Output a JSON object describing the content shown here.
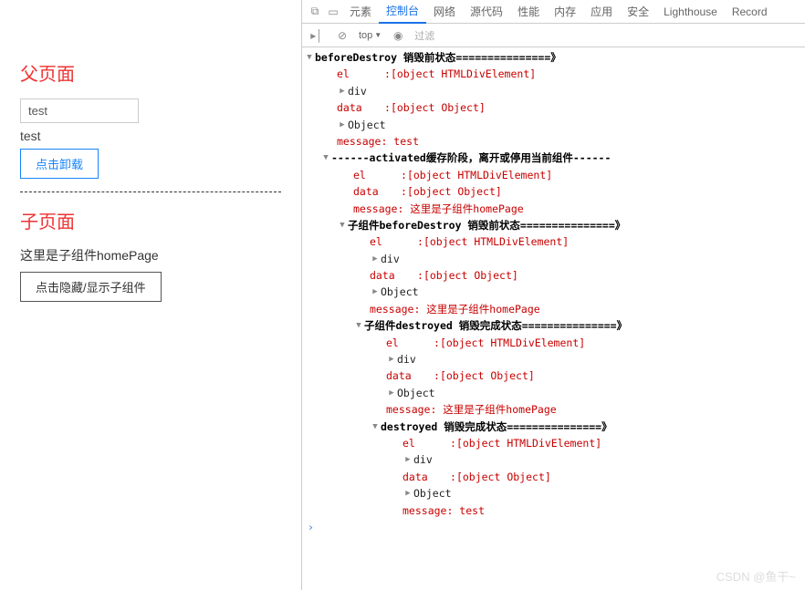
{
  "left": {
    "parentTitle": "父页面",
    "inputValue": "test",
    "echoText": "test",
    "unloadBtn": "点击卸载",
    "childTitle": "子页面",
    "childDesc": "这里是子组件homePage",
    "toggleBtn": "点击隐藏/显示子组件"
  },
  "devtools": {
    "tabs": [
      "元素",
      "控制台",
      "网络",
      "源代码",
      "性能",
      "内存",
      "应用",
      "安全",
      "Lighthouse",
      "Record"
    ],
    "activeTab": "控制台",
    "topSelector": "top",
    "filterPlaceholder": "过滤"
  },
  "log": {
    "g1_header": "beforeDestroy 销毁前状态===============》",
    "g1_el_key": "el",
    "g1_el_val": "[object HTMLDivElement]",
    "g1_div": "div",
    "g1_data_key": "data",
    "g1_data_val": "[object Object]",
    "g1_obj": "Object",
    "g1_msg": "message: test",
    "g2_header": "------activated缓存阶段，离开或停用当前组件------",
    "g2_el_key": "el",
    "g2_el_val": "[object HTMLDivElement]",
    "g2_data_key": "data",
    "g2_data_val": "[object Object]",
    "g2_msg": "message: 这里是子组件homePage",
    "g3_header": "子组件beforeDestroy 销毁前状态===============》",
    "g3_el_key": "el",
    "g3_el_val": "[object HTMLDivElement]",
    "g3_div": "div",
    "g3_data_key": "data",
    "g3_data_val": "[object Object]",
    "g3_obj": "Object",
    "g3_msg": "message: 这里是子组件homePage",
    "g4_header": "子组件destroyed 销毁完成状态===============》",
    "g4_el_key": "el",
    "g4_el_val": "[object HTMLDivElement]",
    "g4_div": "div",
    "g4_data_key": "data",
    "g4_data_val": "[object Object]",
    "g4_obj": "Object",
    "g4_msg": "message: 这里是子组件homePage",
    "g5_header": "destroyed 销毁完成状态===============》",
    "g5_el_key": "el",
    "g5_el_val": "[object HTMLDivElement]",
    "g5_div": "div",
    "g5_data_key": "data",
    "g5_data_val": "[object Object]",
    "g5_obj": "Object",
    "g5_msg": "message: test"
  },
  "watermark": "CSDN @鱼干~"
}
